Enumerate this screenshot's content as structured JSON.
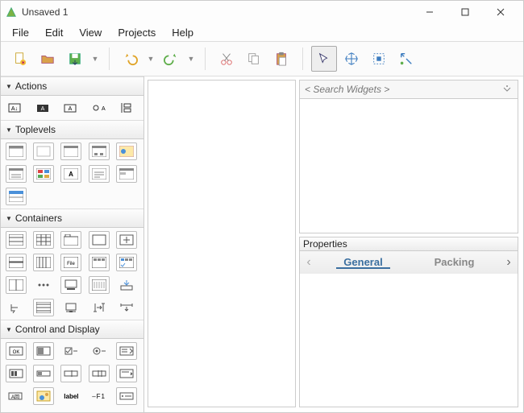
{
  "window": {
    "title": "Unsaved 1"
  },
  "menu": {
    "file": "File",
    "edit": "Edit",
    "view": "View",
    "projects": "Projects",
    "help": "Help"
  },
  "palette": {
    "actions": "Actions",
    "toplevels": "Toplevels",
    "containers": "Containers",
    "control_display": "Control and Display"
  },
  "inspector": {
    "search_placeholder": "< Search Widgets >",
    "properties": "Properties",
    "tab_general": "General",
    "tab_packing": "Packing"
  }
}
